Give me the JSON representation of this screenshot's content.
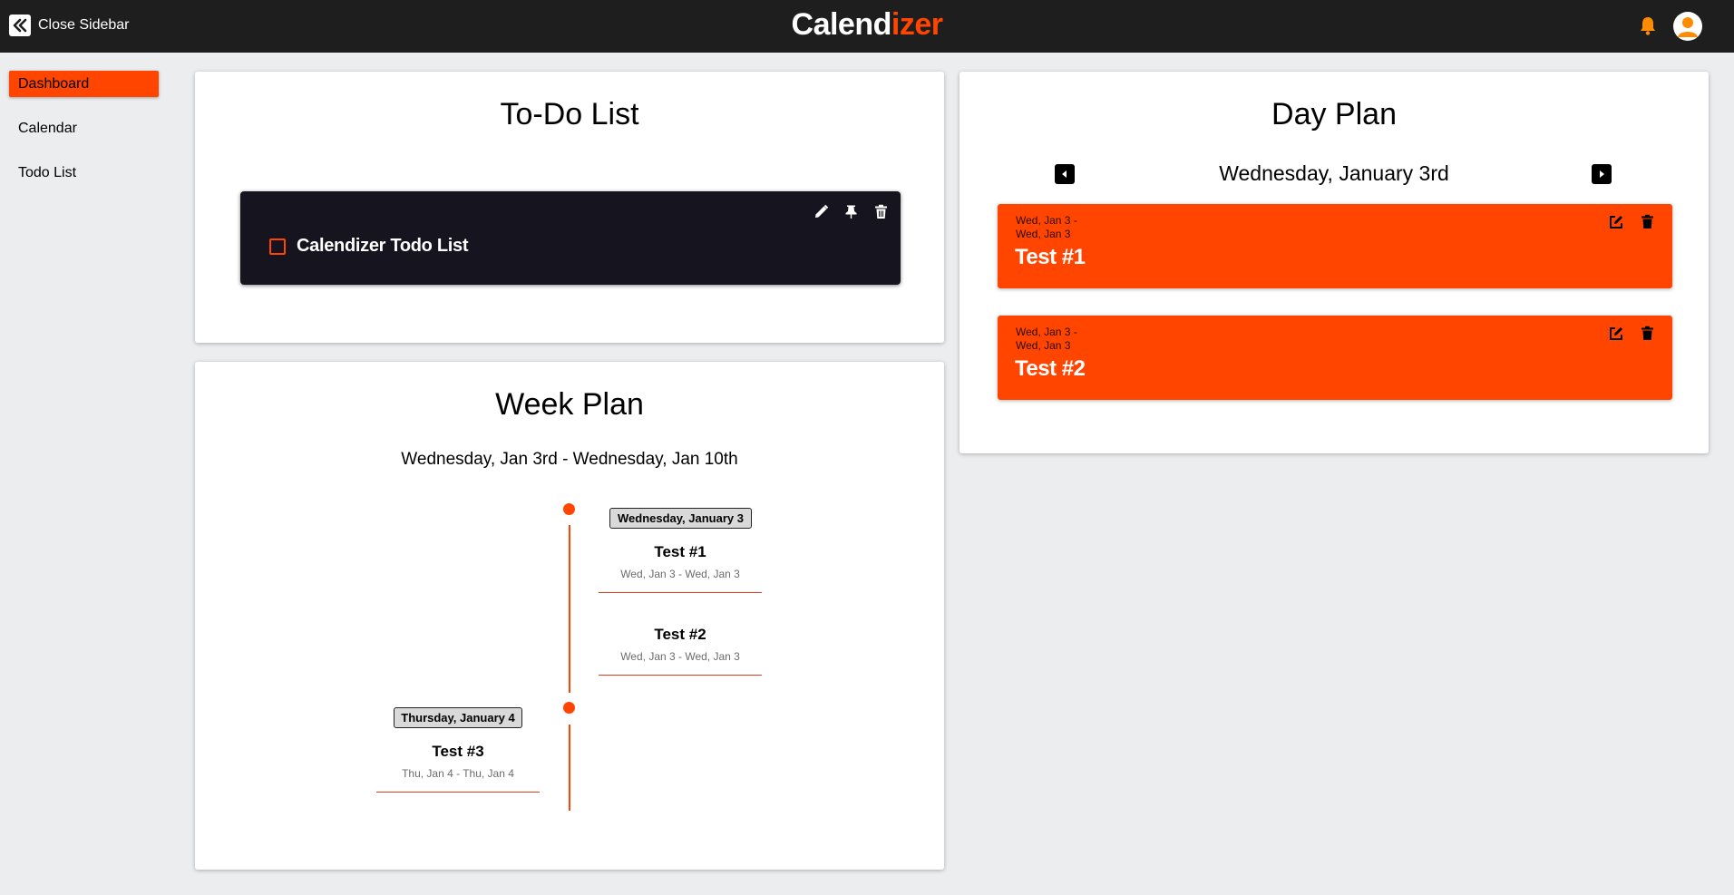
{
  "header": {
    "close_sidebar_label": "Close Sidebar",
    "brand_part1": "Calend",
    "brand_part2": "izer",
    "brand_accent_color": "#ff4500",
    "bell_icon": "bell-icon",
    "avatar_icon": "user-avatar-icon"
  },
  "sidebar": {
    "items": [
      {
        "label": "Dashboard",
        "active": true
      },
      {
        "label": "Calendar",
        "active": false
      },
      {
        "label": "Todo List",
        "active": false
      }
    ]
  },
  "todo": {
    "title": "To-Do List",
    "items": [
      {
        "label": "Calendizer Todo List",
        "checked": false,
        "icons": [
          "pencil-icon",
          "pin-icon",
          "trash-icon"
        ]
      }
    ]
  },
  "week_plan": {
    "title": "Week Plan",
    "range": "Wednesday, Jan 3rd - Wednesday, Jan 10th",
    "groups": [
      {
        "date": "Wednesday, January 3",
        "events": [
          {
            "title": "Test #1",
            "dates": "Wed, Jan 3 - Wed, Jan 3"
          },
          {
            "title": "Test #2",
            "dates": "Wed, Jan 3 - Wed, Jan 3"
          }
        ]
      },
      {
        "date": "Thursday, January 4",
        "events": [
          {
            "title": "Test #3",
            "dates": "Thu, Jan 4 - Thu, Jan 4"
          }
        ]
      }
    ]
  },
  "day_plan": {
    "title": "Day Plan",
    "date": "Wednesday, January 3rd",
    "prev_icon": "arrow-left-icon",
    "next_icon": "arrow-right-icon",
    "events": [
      {
        "range_start": "Wed, Jan 3 -",
        "range_end": "Wed, Jan 3",
        "title": "Test #1",
        "icons": [
          "edit-icon",
          "trash-icon"
        ]
      },
      {
        "range_start": "Wed, Jan 3 -",
        "range_end": "Wed, Jan 3",
        "title": "Test #2",
        "icons": [
          "edit-icon",
          "trash-icon"
        ]
      }
    ]
  }
}
